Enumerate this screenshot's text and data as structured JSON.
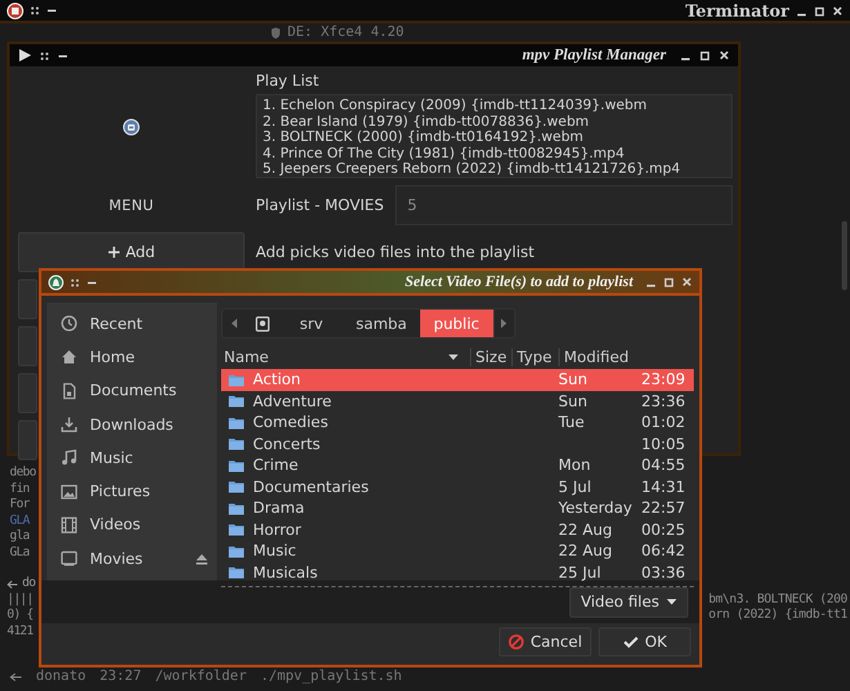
{
  "terminal": {
    "title": "Terminator",
    "info": "DE: Xfce4 4.20",
    "output": [
      {
        "text": "debo",
        "kind": "plain"
      },
      {
        "text": "fin",
        "kind": "plain"
      },
      {
        "text": "For",
        "kind": "plain"
      },
      {
        "text": "GLA",
        "kind": "accent"
      },
      {
        "text": "gla",
        "kind": "plain"
      },
      {
        "text": "GLa",
        "kind": "plain"
      }
    ],
    "session": [
      {
        "text": "do",
        "kind": "prompt"
      },
      {
        "text": "||||",
        "kind": "plain",
        "tail": "bm\\n3. BOLTNECK (200"
      },
      {
        "text": "0) {",
        "kind": "plain",
        "tail": "orn (2022) {imdb-tt1"
      },
      {
        "text": "4121",
        "kind": "plain"
      }
    ],
    "command": {
      "user": "donato",
      "time": "23:27",
      "dir": "/workfolder",
      "cmd": "./mpv_playlist.sh"
    }
  },
  "player": {
    "title": "mpv Playlist Manager",
    "menu_label": "MENU",
    "add_button": "Add",
    "list_label": "Play List",
    "playlist": [
      "1. Echelon Conspiracy (2009) {imdb-tt1124039}.webm",
      "2. Bear Island (1979) {imdb-tt0078836}.webm",
      "3. BOLTNECK (2000) {imdb-tt0164192}.webm",
      "4. Prince Of The City (1981) {imdb-tt0082945}.mp4",
      "5. Jeepers Creepers Reborn (2022) {imdb-tt14121726}.mp4"
    ],
    "name_label": "Playlist - MOVIES",
    "count_field": {
      "value": "5"
    },
    "hint": "Add picks video files into the playlist"
  },
  "dialog": {
    "title": "Select Video File(s) to add to playlist",
    "places": [
      {
        "label": "Recent",
        "kind": "recent"
      },
      {
        "label": "Home",
        "kind": "home"
      },
      {
        "label": "Documents",
        "kind": "documents"
      },
      {
        "label": "Downloads",
        "kind": "downloads"
      },
      {
        "label": "Music",
        "kind": "music"
      },
      {
        "label": "Pictures",
        "kind": "pictures"
      },
      {
        "label": "Videos",
        "kind": "videos"
      },
      {
        "label": "Movies",
        "kind": "drive"
      }
    ],
    "path": [
      {
        "label": "srv",
        "selected": false
      },
      {
        "label": "samba",
        "selected": false
      },
      {
        "label": "public",
        "selected": true
      }
    ],
    "columns": [
      "Name",
      "Size",
      "Type",
      "Modified"
    ],
    "rows": [
      {
        "name": "Action",
        "day": "Sun",
        "time": "23:09",
        "selected": true
      },
      {
        "name": "Adventure",
        "day": "Sun",
        "time": "23:36",
        "selected": false
      },
      {
        "name": "Comedies",
        "day": "Tue",
        "time": "01:02",
        "selected": false
      },
      {
        "name": "Concerts",
        "time": "10:05",
        "selected": false
      },
      {
        "name": "Crime",
        "day": "Mon",
        "time": "04:55",
        "selected": false
      },
      {
        "name": "Documentaries",
        "day": "5 Jul",
        "time": "14:31",
        "selected": false
      },
      {
        "name": "Drama",
        "day": "Yesterday",
        "time": "22:57",
        "selected": false
      },
      {
        "name": "Horror",
        "day": "22 Aug",
        "time": "00:25",
        "selected": false
      },
      {
        "name": "Music",
        "day": "22 Aug",
        "time": "06:42",
        "selected": false
      },
      {
        "name": "Musicals",
        "day": "25 Jul",
        "time": "03:36",
        "selected": false
      }
    ],
    "filter": "Video files",
    "buttons": [
      {
        "label": "Cancel",
        "kind": "cancel"
      },
      {
        "label": "OK",
        "kind": "ok"
      }
    ]
  }
}
